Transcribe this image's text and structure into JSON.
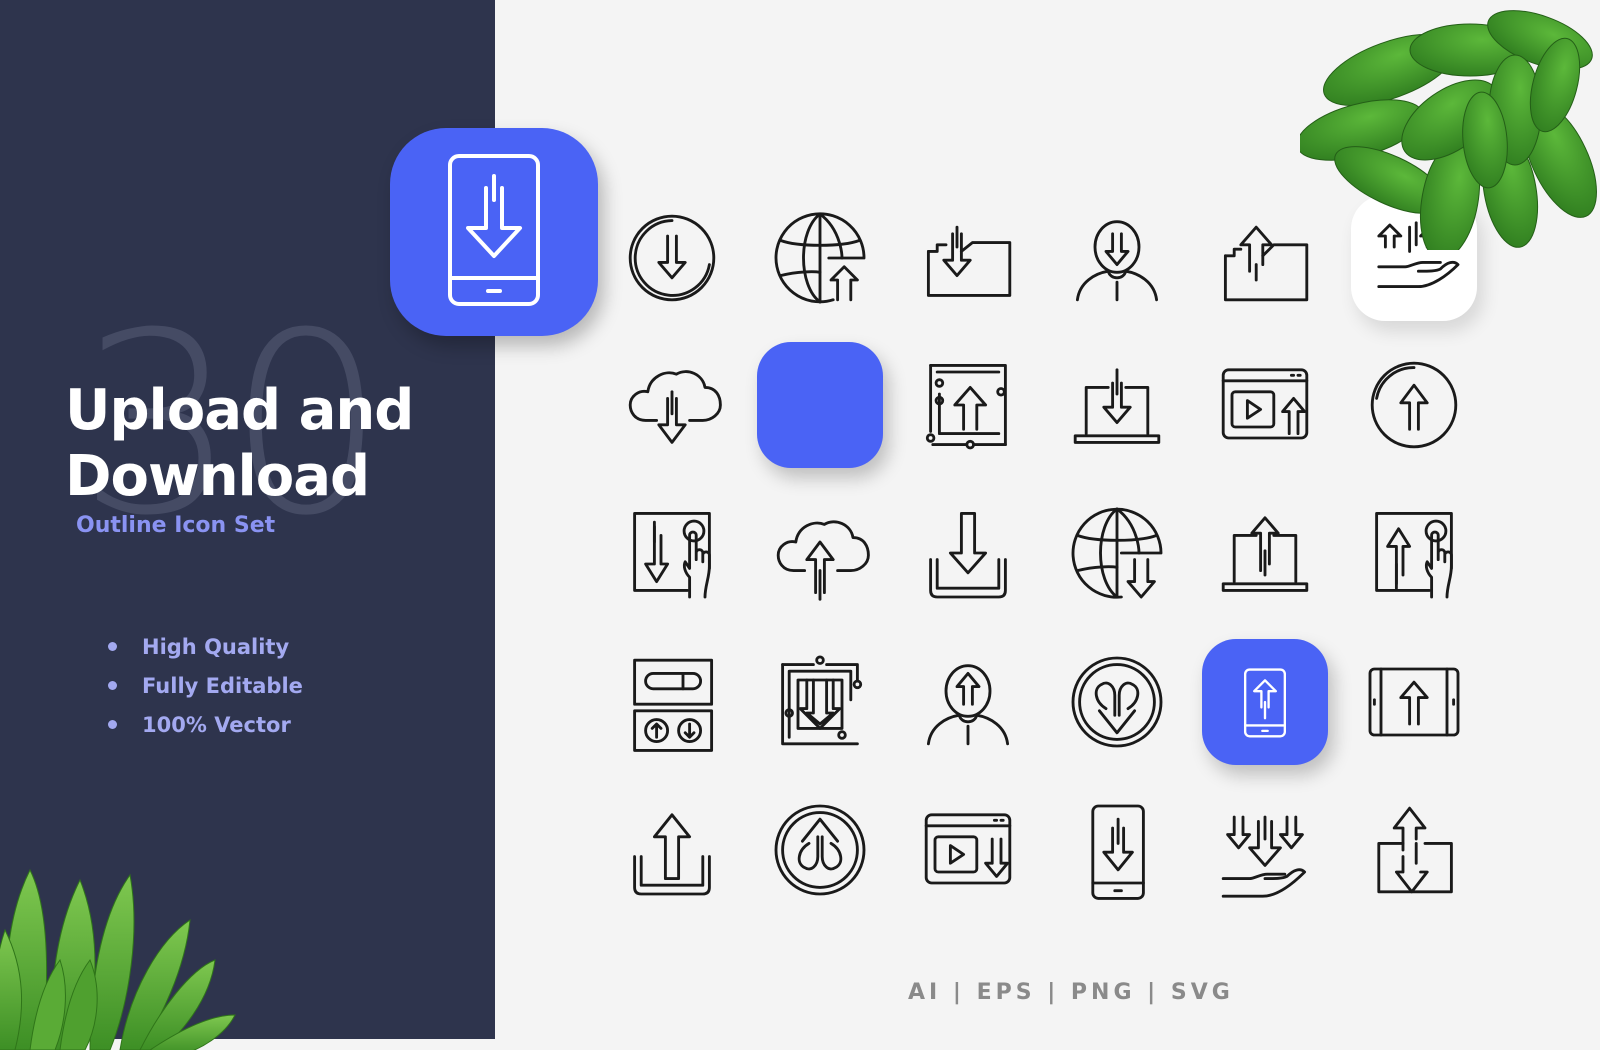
{
  "left_panel": {
    "background_number": "30",
    "title_line1": "Upload and",
    "title_line2": "Download",
    "subtitle": "Outline Icon Set",
    "features": [
      "High Quality",
      "Fully Editable",
      "100% Vector"
    ]
  },
  "formats": "AI | EPS | PNG | SVG",
  "colors": {
    "dark_panel": "#2e344d",
    "accent_blue": "#4a63f5",
    "subtitle_purple": "#8a93f2",
    "feature_lavender": "#a3a9f0",
    "light_bg": "#f4f4f4",
    "icon_stroke": "#1a1a1a"
  },
  "hero_icon": "smartphone-download-icon",
  "icon_grid": [
    [
      "circle-download-icon",
      "globe-upload-icon",
      "folder-download-icon",
      "user-download-icon",
      "folder-upload-icon",
      "hand-upload-icon"
    ],
    [
      "cloud-download-icon",
      "tablet-download-icon",
      "circuit-upload-icon",
      "laptop-download-icon",
      "video-upload-icon",
      "circle-upload-icon"
    ],
    [
      "touch-download-icon",
      "cloud-upload-icon",
      "tray-download-icon",
      "globe-download-icon",
      "laptop-upload-icon",
      "touch-upload-icon"
    ],
    [
      "transfer-device-icon",
      "circuit-download-icon",
      "user-upload-icon",
      "round-download-icon",
      "smartphone-upload-icon",
      "tablet-upload-icon"
    ],
    [
      "tray-upload-icon",
      "round-upload-icon",
      "video-download-icon",
      "smartphone-download-icon",
      "hand-download-icon",
      "box-upload-download-icon"
    ]
  ]
}
